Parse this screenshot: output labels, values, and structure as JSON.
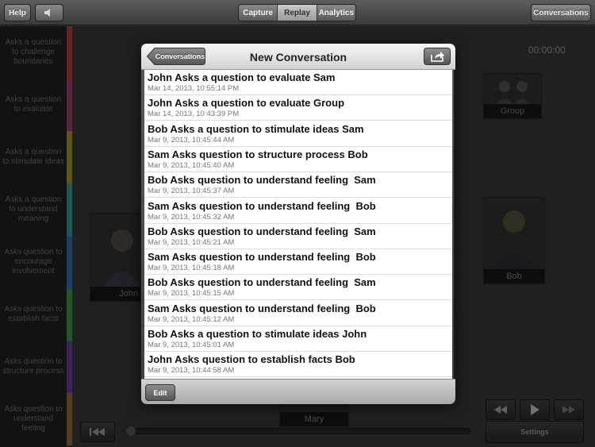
{
  "toolbar": {
    "help_label": "Help",
    "mute_icon": "speaker-icon",
    "tabs": [
      {
        "label": "Capture",
        "active": false
      },
      {
        "label": "Replay",
        "active": true
      },
      {
        "label": "Analytics",
        "active": false
      }
    ],
    "conversations_label": "Conversations"
  },
  "categories": [
    {
      "label": "Asks a question to challenge boundaries",
      "color": "#7a2a2a"
    },
    {
      "label": "Asks a question to evaluate",
      "color": "#6a2f4a"
    },
    {
      "label": "Asks a question to stimulate ideas",
      "color": "#6d6a2a"
    },
    {
      "label": "Asks a question to understand meaning",
      "color": "#2a6a6a"
    },
    {
      "label": "Asks question to encourage involvement",
      "color": "#2a4a7a"
    },
    {
      "label": "Asks question to establish facts",
      "color": "#2e6a34"
    },
    {
      "label": "Asks question to structure process",
      "color": "#4a2e6a"
    },
    {
      "label": "Asks question to understand feeling",
      "color": "#6a4a2a"
    }
  ],
  "timer": "00:00:00",
  "participants": {
    "group": "Group",
    "john": "John",
    "bob": "Bob",
    "mary": "Mary"
  },
  "playback": {
    "settings_label": "Settings",
    "rewind_icon": "rewind-icon",
    "play_icon": "play-icon",
    "forward_icon": "fast-forward-icon",
    "skip_back_icon": "skip-to-start-icon"
  },
  "popover": {
    "back_label": "Conversations",
    "title": "New Conversation",
    "share_icon": "share-icon",
    "edit_label": "Edit",
    "items": [
      {
        "title": "John Asks a question to evaluate Sam",
        "date": "Mar 14, 2013, 10:55:14 PM"
      },
      {
        "title": "John Asks a question to evaluate Group",
        "date": "Mar 14, 2013, 10:43:39 PM"
      },
      {
        "title": "Bob Asks a question to stimulate ideas Sam",
        "date": "Mar 9, 2013, 10:45:44 AM"
      },
      {
        "title": "Sam Asks question to structure process Bob",
        "date": "Mar 9, 2013, 10:45:40 AM"
      },
      {
        "title": "Bob Asks question to understand feeling  Sam",
        "date": "Mar 9, 2013, 10:45:37 AM"
      },
      {
        "title": "Sam Asks question to understand feeling  Bob",
        "date": "Mar 9, 2013, 10:45:32 AM"
      },
      {
        "title": "Bob Asks question to understand feeling  Sam",
        "date": "Mar 9, 2013, 10:45:21 AM"
      },
      {
        "title": "Sam Asks question to understand feeling  Bob",
        "date": "Mar 9, 2013, 10:45:18 AM"
      },
      {
        "title": "Bob Asks question to understand feeling  Sam",
        "date": "Mar 9, 2013, 10:45:15 AM"
      },
      {
        "title": "Sam Asks question to understand feeling  Bob",
        "date": "Mar 9, 2013, 10:45:12 AM"
      },
      {
        "title": "Bob Asks a question to stimulate ideas John",
        "date": "Mar 9, 2013, 10:45:01 AM"
      },
      {
        "title": "John Asks question to establish facts Bob",
        "date": "Mar 9, 2013, 10:44:58 AM"
      }
    ]
  }
}
